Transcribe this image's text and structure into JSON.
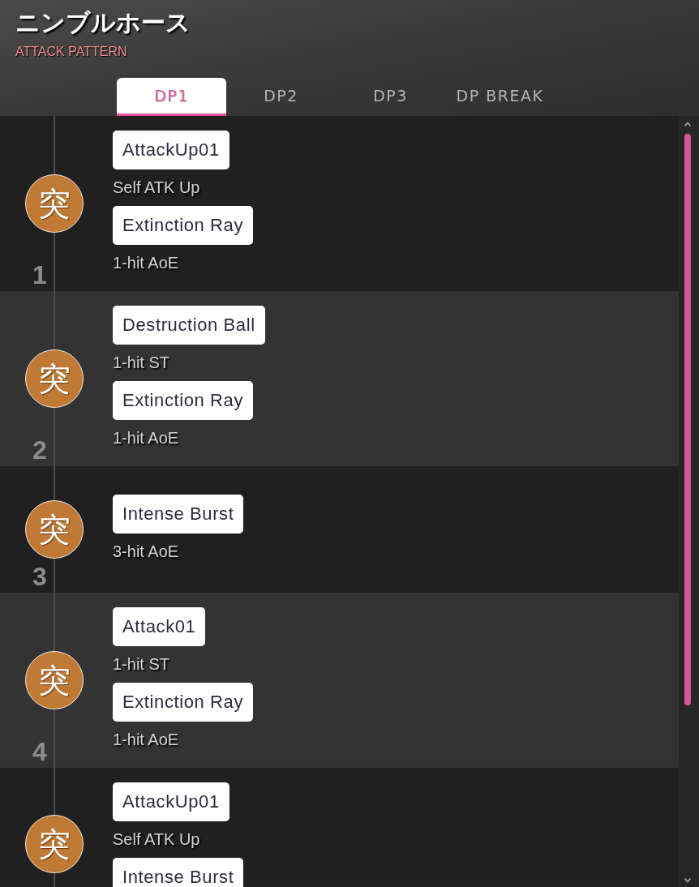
{
  "header": {
    "title": "ニンブルホース",
    "subtitle": "ATTACK PATTERN"
  },
  "tabs": [
    {
      "label": "DP1",
      "selected": true
    },
    {
      "label": "DP2",
      "selected": false
    },
    {
      "label": "DP3",
      "selected": false
    },
    {
      "label": "DP BREAK",
      "selected": false
    }
  ],
  "turns": [
    {
      "number": "1",
      "type": "突",
      "actions": [
        {
          "skill": "AttackUp01",
          "effect": "Self ATK Up"
        },
        {
          "skill": "Extinction Ray",
          "effect": "1-hit AoE"
        }
      ]
    },
    {
      "number": "2",
      "type": "突",
      "actions": [
        {
          "skill": "Destruction Ball",
          "effect": "1-hit ST"
        },
        {
          "skill": "Extinction Ray",
          "effect": "1-hit AoE"
        }
      ]
    },
    {
      "number": "3",
      "type": "突",
      "actions": [
        {
          "skill": "Intense Burst",
          "effect": "3-hit AoE"
        }
      ]
    },
    {
      "number": "4",
      "type": "突",
      "actions": [
        {
          "skill": "Attack01",
          "effect": "1-hit ST"
        },
        {
          "skill": "Extinction Ray",
          "effect": "1-hit AoE"
        }
      ]
    },
    {
      "type": "突",
      "actions": [
        {
          "skill": "AttackUp01",
          "effect": "Self ATK Up"
        },
        {
          "skill": "Intense Burst"
        }
      ]
    }
  ]
}
